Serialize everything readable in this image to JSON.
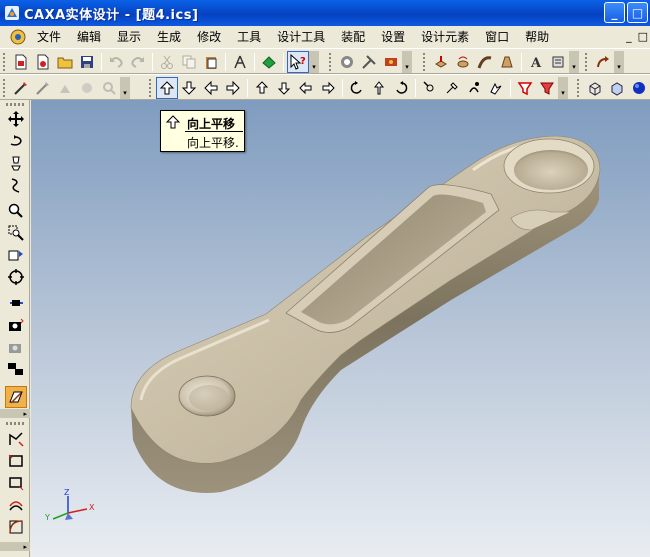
{
  "window": {
    "title": "CAXA实体设计 - [题4.ics]",
    "buttons": {
      "minimize": "_",
      "maximize": "□"
    }
  },
  "menu": {
    "items": [
      "文件",
      "编辑",
      "显示",
      "生成",
      "修改",
      "工具",
      "设计工具",
      "装配",
      "设置",
      "设计元素",
      "窗口",
      "帮助"
    ],
    "mdi": {
      "minimize": "_",
      "restore": "□"
    }
  },
  "tooltip": {
    "title": "向上平移",
    "description": "向上平移."
  },
  "axes": {
    "x": "X",
    "y": "Y",
    "z": "Z"
  },
  "colors": {
    "titlebar": "#0647c9",
    "viewport_top": "#7f9cbf",
    "viewport_bottom": "#e9edf2",
    "model": "#c8bca4",
    "tooltip_bg": "#ffffe1"
  }
}
